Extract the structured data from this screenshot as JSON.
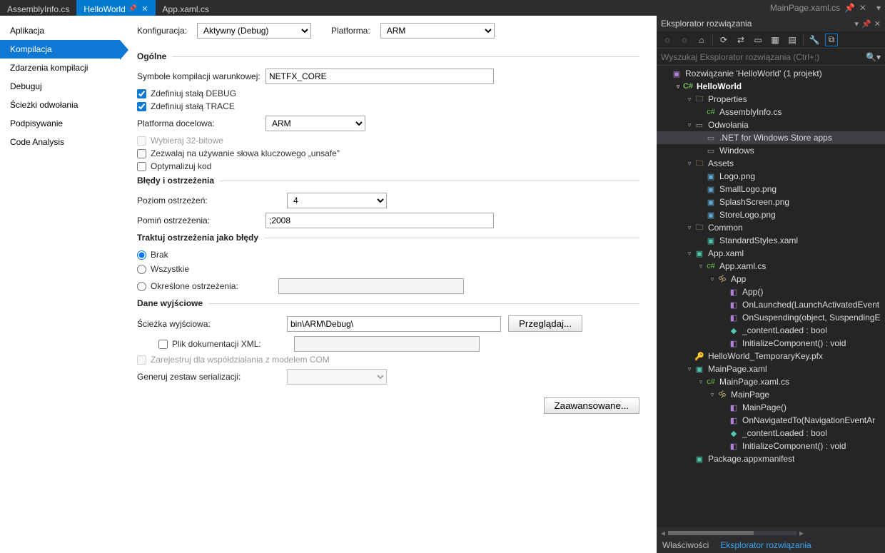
{
  "tabs": {
    "t0": "AssemblyInfo.cs",
    "t1": "HelloWorld",
    "t2": "App.xaml.cs",
    "far": "MainPage.xaml.cs"
  },
  "sidebar": [
    "Aplikacja",
    "Kompilacja",
    "Zdarzenia kompilacji",
    "Debuguj",
    "Ścieżki odwołania",
    "Podpisywanie",
    "Code Analysis"
  ],
  "topform": {
    "config_label": "Konfiguracja:",
    "config_value": "Aktywny (Debug)",
    "platform_label": "Platforma:",
    "platform_value": "ARM"
  },
  "general": {
    "title": "Ogólne",
    "sym_label": "Symbole kompilacji warunkowej:",
    "sym_value": "NETFX_CORE",
    "chk_debug": "Zdefiniuj stałą DEBUG",
    "chk_trace": "Zdefiniuj stałą TRACE",
    "target_label": "Platforma docelowa:",
    "target_value": "ARM",
    "chk_32": "Wybieraj 32-bitowe",
    "chk_unsafe": "Zezwalaj na używanie słowa kluczowego „unsafe”",
    "chk_opt": "Optymalizuj kod"
  },
  "warn": {
    "title": "Błędy i ostrzeżenia",
    "level_label": "Poziom ostrzeżeń:",
    "level_value": "4",
    "skip_label": "Pomiń ostrzeżenia:",
    "skip_value": ";2008"
  },
  "treatwarn": {
    "title": "Traktuj ostrzeżenia jako błędy",
    "r1": "Brak",
    "r2": "Wszystkie",
    "r3": "Określone ostrzeżenia:"
  },
  "output": {
    "title": "Dane wyjściowe",
    "path_label": "Ścieżka wyjściowa:",
    "path_value": "bin\\ARM\\Debug\\",
    "browse": "Przeglądaj...",
    "chk_xml": "Plik dokumentacji XML:",
    "chk_com": "Zarejestruj dla współdziałania z modelem COM",
    "gen_label": "Generuj zestaw serializacji:",
    "adv": "Zaawansowane..."
  },
  "panel": {
    "title": "Eksplorator rozwiązania",
    "search_ph": "Wyszukaj Eksplorator rozwiązania (Ctrl+;)"
  },
  "tree": [
    {
      "d": 0,
      "a": "",
      "i": "ic-sln",
      "g": "▣",
      "t": "Rozwiązanie 'HelloWorld' (1 projekt)",
      "b": 0,
      "s": 0
    },
    {
      "d": 1,
      "a": "▿",
      "i": "ic-proj",
      "g": "C#",
      "t": "HelloWorld",
      "b": 1,
      "s": 0
    },
    {
      "d": 2,
      "a": "▿",
      "i": "ic-fld",
      "g": "🗀",
      "t": "Properties",
      "b": 0,
      "s": 0
    },
    {
      "d": 3,
      "a": "",
      "i": "ic-cs",
      "g": "c#",
      "t": "AssemblyInfo.cs",
      "b": 0,
      "s": 0
    },
    {
      "d": 2,
      "a": "▿",
      "i": "ic-ref",
      "g": "▭",
      "t": "Odwołania",
      "b": 0,
      "s": 0
    },
    {
      "d": 3,
      "a": "",
      "i": "ic-ref",
      "g": "▭",
      "t": ".NET for Windows Store apps",
      "b": 0,
      "s": 1
    },
    {
      "d": 3,
      "a": "",
      "i": "ic-ref",
      "g": "▭",
      "t": "Windows",
      "b": 0,
      "s": 0
    },
    {
      "d": 2,
      "a": "▿",
      "i": "ic-fld",
      "g": "🗀",
      "t": "Assets",
      "b": 0,
      "s": 0
    },
    {
      "d": 3,
      "a": "",
      "i": "ic-img",
      "g": "▣",
      "t": "Logo.png",
      "b": 0,
      "s": 0
    },
    {
      "d": 3,
      "a": "",
      "i": "ic-img",
      "g": "▣",
      "t": "SmallLogo.png",
      "b": 0,
      "s": 0
    },
    {
      "d": 3,
      "a": "",
      "i": "ic-img",
      "g": "▣",
      "t": "SplashScreen.png",
      "b": 0,
      "s": 0
    },
    {
      "d": 3,
      "a": "",
      "i": "ic-img",
      "g": "▣",
      "t": "StoreLogo.png",
      "b": 0,
      "s": 0
    },
    {
      "d": 2,
      "a": "▿",
      "i": "ic-fld",
      "g": "🗀",
      "t": "Common",
      "b": 0,
      "s": 0
    },
    {
      "d": 3,
      "a": "",
      "i": "ic-xaml",
      "g": "▣",
      "t": "StandardStyles.xaml",
      "b": 0,
      "s": 0
    },
    {
      "d": 2,
      "a": "▿",
      "i": "ic-xaml",
      "g": "▣",
      "t": "App.xaml",
      "b": 0,
      "s": 0
    },
    {
      "d": 3,
      "a": "▿",
      "i": "ic-cs",
      "g": "c#",
      "t": "App.xaml.cs",
      "b": 0,
      "s": 0
    },
    {
      "d": 4,
      "a": "▿",
      "i": "ic-class",
      "g": "🝰",
      "t": "App",
      "b": 0,
      "s": 0
    },
    {
      "d": 5,
      "a": "",
      "i": "ic-meth",
      "g": "◧",
      "t": "App()",
      "b": 0,
      "s": 0
    },
    {
      "d": 5,
      "a": "",
      "i": "ic-meth",
      "g": "◧",
      "t": "OnLaunched(LaunchActivatedEvent",
      "b": 0,
      "s": 0
    },
    {
      "d": 5,
      "a": "",
      "i": "ic-meth",
      "g": "◧",
      "t": "OnSuspending(object, SuspendingE",
      "b": 0,
      "s": 0
    },
    {
      "d": 5,
      "a": "",
      "i": "ic-field",
      "g": "◆",
      "t": "_contentLoaded : bool",
      "b": 0,
      "s": 0
    },
    {
      "d": 5,
      "a": "",
      "i": "ic-meth",
      "g": "◧",
      "t": "InitializeComponent() : void",
      "b": 0,
      "s": 0
    },
    {
      "d": 2,
      "a": "",
      "i": "ic-key",
      "g": "🔑",
      "t": "HelloWorld_TemporaryKey.pfx",
      "b": 0,
      "s": 0
    },
    {
      "d": 2,
      "a": "▿",
      "i": "ic-xaml",
      "g": "▣",
      "t": "MainPage.xaml",
      "b": 0,
      "s": 0
    },
    {
      "d": 3,
      "a": "▿",
      "i": "ic-cs",
      "g": "c#",
      "t": "MainPage.xaml.cs",
      "b": 0,
      "s": 0
    },
    {
      "d": 4,
      "a": "▿",
      "i": "ic-class",
      "g": "🝰",
      "t": "MainPage",
      "b": 0,
      "s": 0
    },
    {
      "d": 5,
      "a": "",
      "i": "ic-meth",
      "g": "◧",
      "t": "MainPage()",
      "b": 0,
      "s": 0
    },
    {
      "d": 5,
      "a": "",
      "i": "ic-meth",
      "g": "◧",
      "t": "OnNavigatedTo(NavigationEventAr",
      "b": 0,
      "s": 0
    },
    {
      "d": 5,
      "a": "",
      "i": "ic-field",
      "g": "◆",
      "t": "_contentLoaded : bool",
      "b": 0,
      "s": 0
    },
    {
      "d": 5,
      "a": "",
      "i": "ic-meth",
      "g": "◧",
      "t": "InitializeComponent() : void",
      "b": 0,
      "s": 0
    },
    {
      "d": 2,
      "a": "",
      "i": "ic-xml",
      "g": "▣",
      "t": "Package.appxmanifest",
      "b": 0,
      "s": 0
    }
  ],
  "bottom": {
    "t1": "Właściwości",
    "t2": "Eksplorator rozwiązania"
  }
}
